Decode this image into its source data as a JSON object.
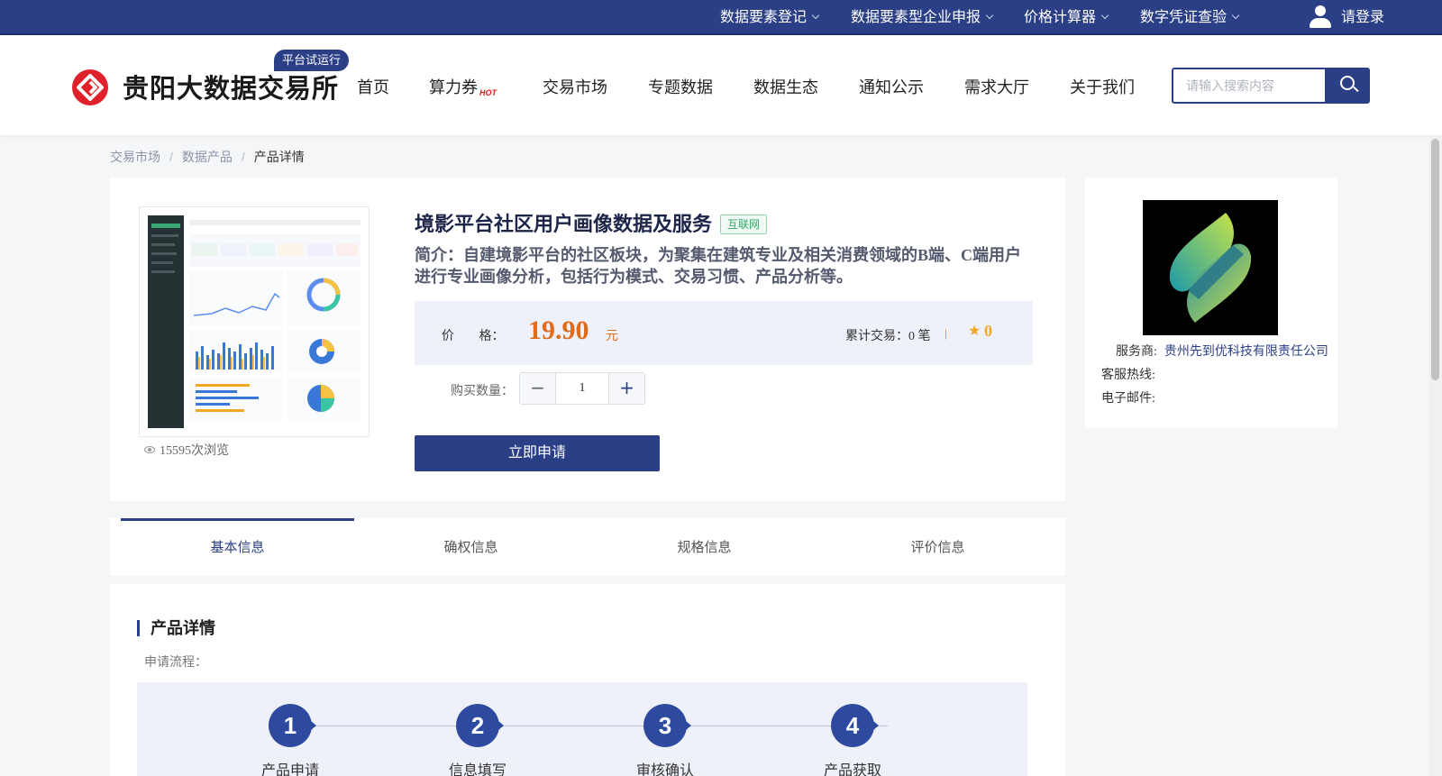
{
  "topbar": {
    "items": [
      "数据要素登记",
      "数据要素型企业申报",
      "价格计算器",
      "数字凭证查验"
    ],
    "login": "请登录"
  },
  "header": {
    "site_name": "贵阳大数据交易所",
    "trial_badge": "平台试运行",
    "nav": [
      "首页",
      "算力券",
      "交易市场",
      "专题数据",
      "数据生态",
      "通知公示",
      "需求大厅",
      "关于我们"
    ],
    "hot_tag": "HOT",
    "search_placeholder": "请输入搜索内容"
  },
  "breadcrumb": [
    "交易市场",
    "数据产品",
    "产品详情"
  ],
  "product": {
    "title": "境影平台社区用户画像数据及服务",
    "category": "互联网",
    "summary": "简介：自建境影平台的社区板块，为聚集在建筑专业及相关消费领域的B端、C端用户进行专业画像分析，包括行为模式、交易习惯、产品分析等。",
    "price_label": "价 格：",
    "price": "19.90",
    "price_unit": "元",
    "trades": "累计交易：0 笔",
    "trades_sep": "|",
    "rating": "0",
    "qty_label": "购买数量：",
    "qty": "1",
    "apply": "立即申请",
    "views": "15595次浏览"
  },
  "vendor": {
    "provider_label": "服务商:",
    "provider": "贵州先到优科技有限责任公司",
    "hotline_label": "客服热线:",
    "email_label": "电子邮件:"
  },
  "tabs": [
    "基本信息",
    "确权信息",
    "规格信息",
    "评价信息"
  ],
  "detail": {
    "title": "产品详情",
    "flow_label": "申请流程：",
    "steps": [
      {
        "num": "1",
        "label": "产品申请"
      },
      {
        "num": "2",
        "label": "信息填写"
      },
      {
        "num": "3",
        "label": "审核确认"
      },
      {
        "num": "4",
        "label": "产品获取"
      }
    ]
  },
  "colors": {
    "brand": "#2b3f86",
    "price": "#e06b1a",
    "star": "#f5a623",
    "logo_red": "#e0202a"
  },
  "icons": [
    "user-icon",
    "search-icon",
    "star-icon",
    "eye-icon",
    "chevron-down-icon"
  ]
}
